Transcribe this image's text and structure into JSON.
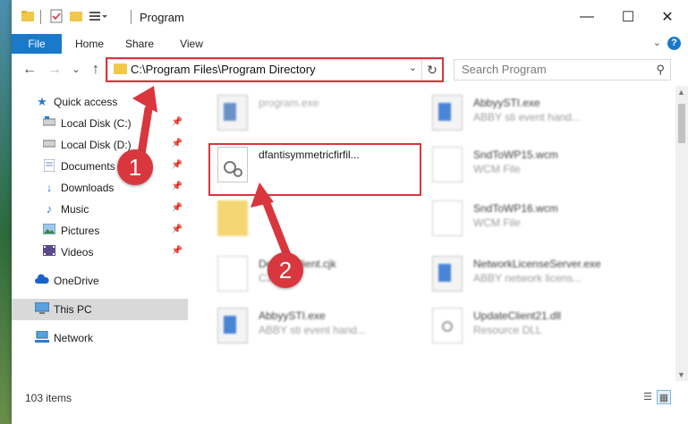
{
  "window": {
    "title": "Program",
    "controls": {
      "minimize": "—",
      "maximize": "☐",
      "close": "✕"
    }
  },
  "ribbon": {
    "tabs": [
      "File",
      "Home",
      "Share",
      "View"
    ],
    "help": "?"
  },
  "navigation": {
    "address": "C:\\Program Files\\Program Directory",
    "search_placeholder": "Search Program"
  },
  "sidebar": {
    "items": [
      {
        "label": "Quick access",
        "icon": "star-icon",
        "pinned": false
      },
      {
        "label": "Local Disk (C:)",
        "icon": "drive-icon",
        "pinned": true
      },
      {
        "label": "Local Disk (D:)",
        "icon": "drive-icon",
        "pinned": true
      },
      {
        "label": "Documents",
        "icon": "documents-icon",
        "pinned": true
      },
      {
        "label": "Downloads",
        "icon": "download-icon",
        "pinned": true
      },
      {
        "label": "Music",
        "icon": "music-icon",
        "pinned": true
      },
      {
        "label": "Pictures",
        "icon": "pictures-icon",
        "pinned": true
      },
      {
        "label": "Videos",
        "icon": "videos-icon",
        "pinned": true
      },
      {
        "label": "OneDrive",
        "icon": "cloud-icon",
        "pinned": false
      },
      {
        "label": "This PC",
        "icon": "computer-icon",
        "pinned": false,
        "selected": true
      },
      {
        "label": "Network",
        "icon": "network-icon",
        "pinned": false
      }
    ]
  },
  "files": [
    {
      "name": "program.exe",
      "desc": "",
      "icon": "program-icon"
    },
    {
      "name": "AbbyySTI.exe",
      "desc": "ABBY sti event hand...",
      "icon": "exe-icon"
    },
    {
      "name": "dfantisymmetricfirfil...",
      "desc": "",
      "icon": "settings-file-icon"
    },
    {
      "name": "SndToWP15.wcm",
      "desc": "WCM File",
      "icon": "file-icon"
    },
    {
      "name": "",
      "desc": "",
      "icon": "folder-icon"
    },
    {
      "name": "SndToWP16.wcm",
      "desc": "WCM File",
      "icon": "file-icon"
    },
    {
      "name": "DefaultClient.cjk",
      "desc": "CJK File",
      "icon": "file-icon"
    },
    {
      "name": "NetworkLicenseServer.exe",
      "desc": "ABBY network licens...",
      "icon": "exe-icon"
    },
    {
      "name": "AbbyySTI.exe",
      "desc": "ABBY sti event hand...",
      "icon": "exe-icon"
    },
    {
      "name": "UpdateClient21.dll",
      "desc": "Resource DLL",
      "icon": "dll-icon"
    }
  ],
  "status": {
    "count": "103 items"
  },
  "annotations": {
    "callout1": "1",
    "callout2": "2",
    "color": "#d9363e"
  }
}
